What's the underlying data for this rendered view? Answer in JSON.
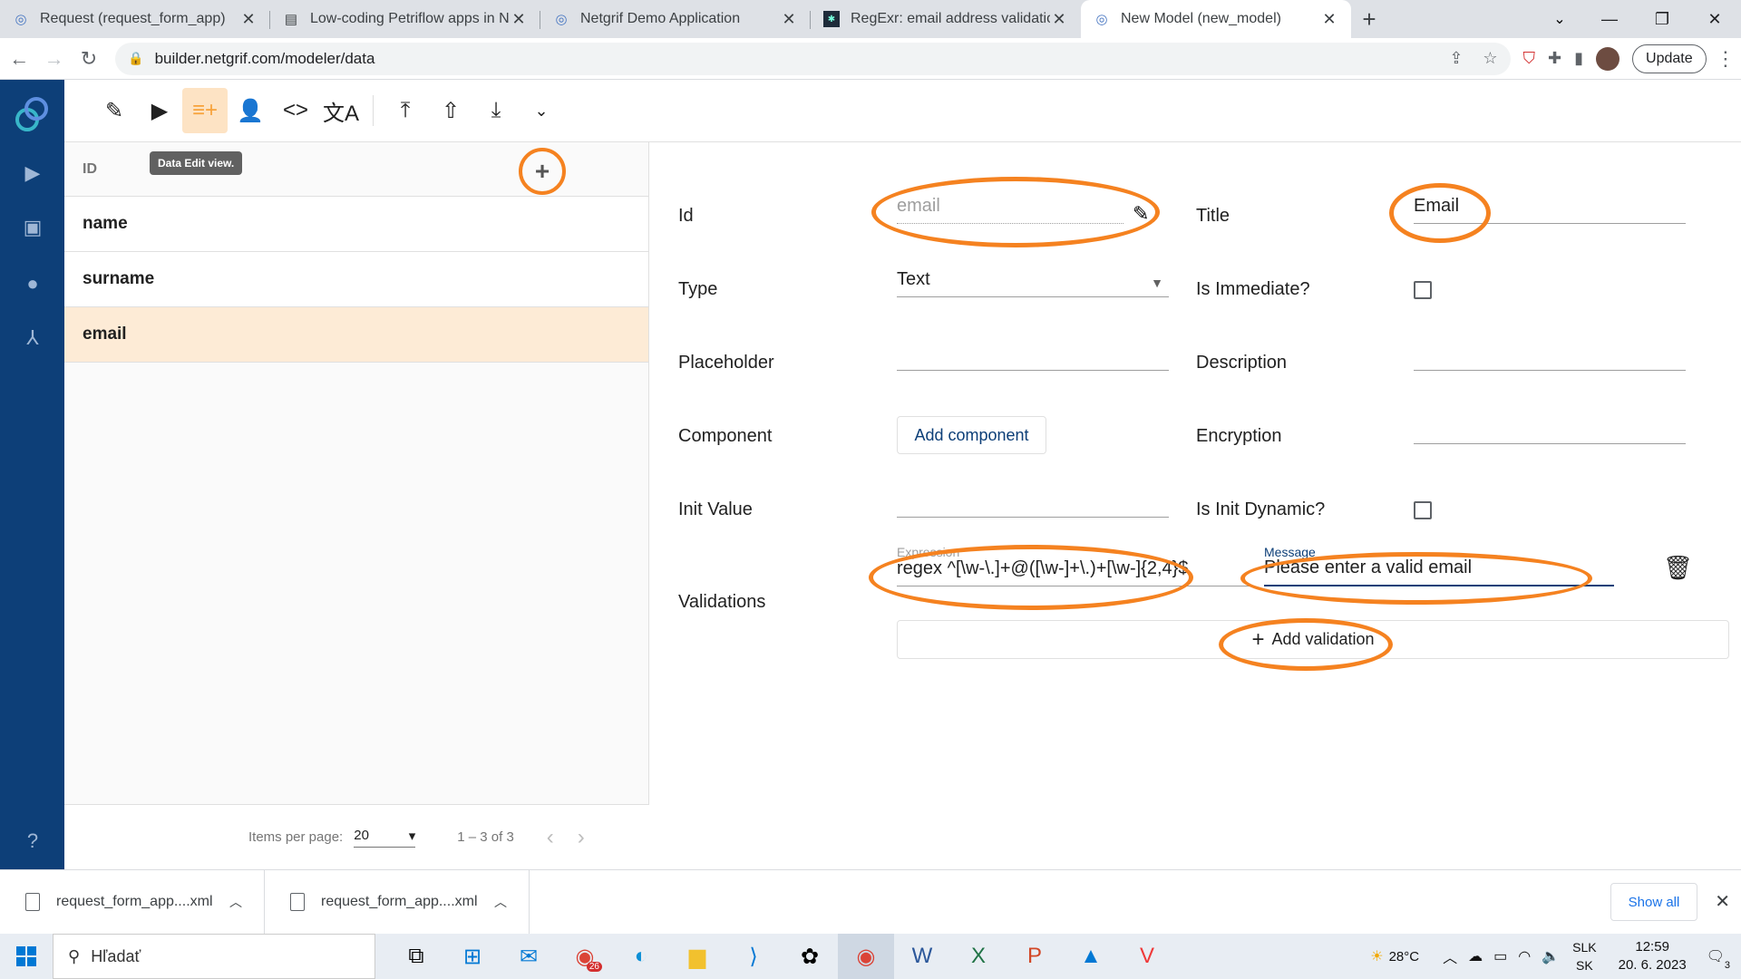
{
  "browser": {
    "tabs": [
      {
        "title": "Request (request_form_app)",
        "icon": "netgrif-icon",
        "active": false
      },
      {
        "title": "Low-coding Petriflow apps in Net",
        "icon": "document-icon",
        "active": false
      },
      {
        "title": "Netgrif Demo Application",
        "icon": "netgrif-icon",
        "active": false
      },
      {
        "title": "RegExr: email address validation",
        "icon": "regexr-icon",
        "active": false
      },
      {
        "title": "New Model (new_model)",
        "icon": "netgrif-icon",
        "active": true
      }
    ],
    "url": "builder.netgrif.com/modeler/data",
    "update_label": "Update"
  },
  "toolbar": {
    "tooltip": "Data Edit view."
  },
  "list": {
    "header": "ID",
    "items": [
      "name",
      "surname",
      "email"
    ],
    "selected_index": 2,
    "paginator": {
      "items_per_page_label": "Items per page:",
      "items_per_page": "20",
      "range": "1 – 3 of 3"
    }
  },
  "editor": {
    "id_label": "Id",
    "id_value": "email",
    "title_label": "Title",
    "title_value": "Email",
    "type_label": "Type",
    "type_value": "Text",
    "immediate_label": "Is Immediate?",
    "placeholder_label": "Placeholder",
    "description_label": "Description",
    "component_label": "Component",
    "add_component_label": "Add component",
    "encryption_label": "Encryption",
    "init_value_label": "Init Value",
    "init_dynamic_label": "Is Init Dynamic?",
    "validations_label": "Validations",
    "expression_label": "Expression",
    "expression_value": "regex ^[\\w-\\.]+@([\\w-]+\\.)+[\\w-]{2,4}$",
    "message_label": "Message",
    "message_value": "Please enter a valid email",
    "add_validation_label": "Add validation"
  },
  "downloads": {
    "items": [
      "request_form_app....xml",
      "request_form_app....xml"
    ],
    "show_all_label": "Show all"
  },
  "taskbar": {
    "search_placeholder": "Hľadať",
    "mail_badge": "26",
    "weather": "28°C",
    "lang_top": "SLK",
    "lang_bottom": "SK",
    "time": "12:59",
    "date": "20. 6. 2023",
    "notifications": "3"
  },
  "colors": {
    "accent": "#f58220",
    "sidebar": "#0d3f78",
    "selected_row": "#fdebd6"
  }
}
